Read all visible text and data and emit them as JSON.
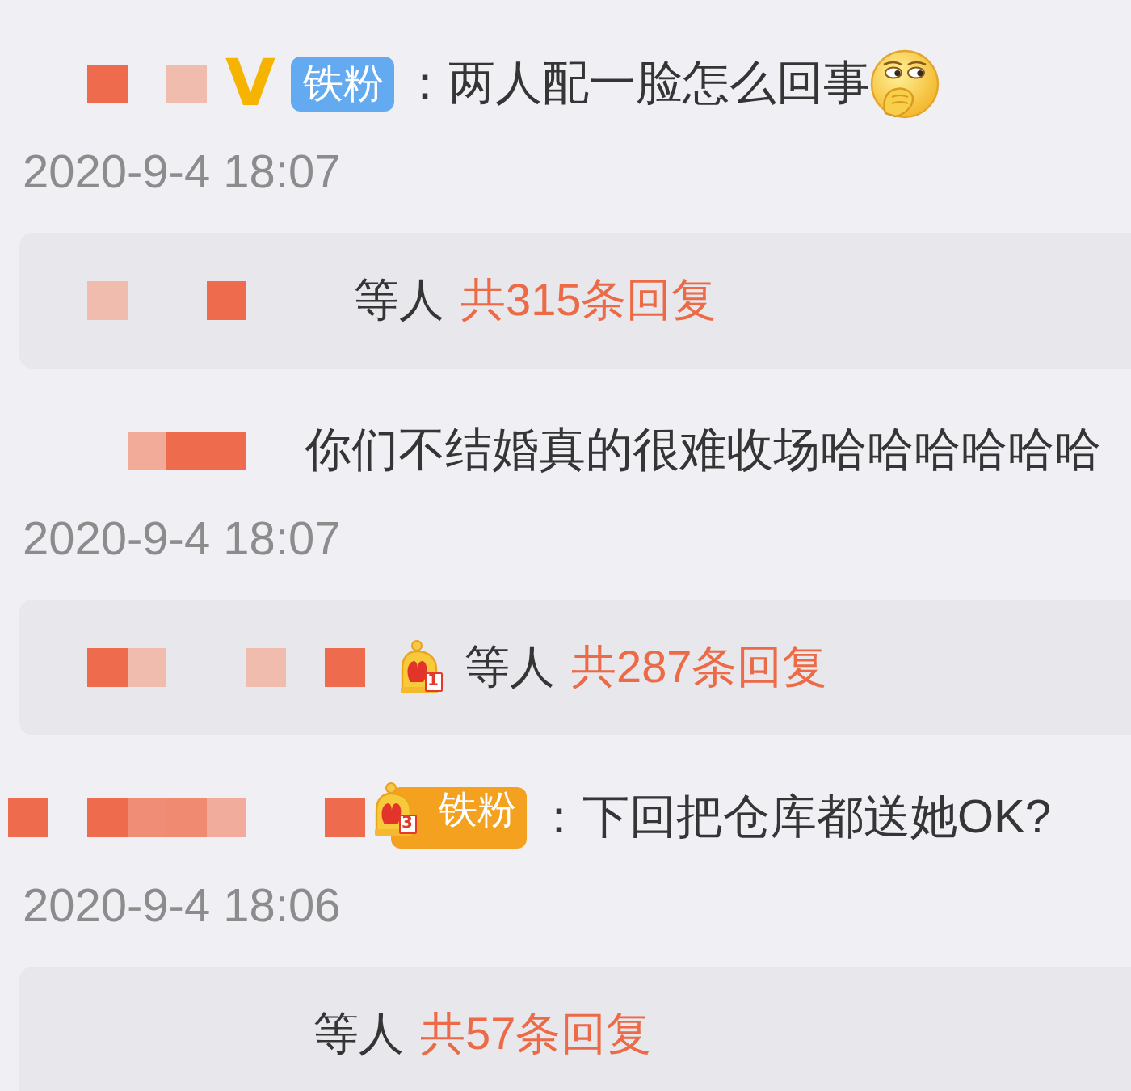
{
  "comments": [
    {
      "name_mosaic": [
        {
          "kind": "blank"
        },
        {
          "kind": "blank"
        },
        {
          "kind": "tile",
          "color": "#ee6c4d"
        },
        {
          "kind": "blank"
        },
        {
          "kind": "tile",
          "color": "#f0bcae"
        }
      ],
      "verified_mark": "V",
      "badge": {
        "kind": "plain",
        "label": "铁粉"
      },
      "text": "：两人配一脸怎么回事",
      "emoji": true,
      "time": "2020-9-4 18:07",
      "replies": {
        "name_mosaic": [
          {
            "kind": "blank"
          },
          {
            "kind": "blank"
          },
          {
            "kind": "tile",
            "color": "#f0bcae"
          },
          {
            "kind": "blank"
          },
          {
            "kind": "blank"
          },
          {
            "kind": "tile",
            "color": "#ee6c4d"
          },
          {
            "kind": "blank"
          },
          {
            "kind": "blank"
          }
        ],
        "label": "等人",
        "count": "共315条回复"
      }
    },
    {
      "name_mosaic": [
        {
          "kind": "blank"
        },
        {
          "kind": "blank"
        },
        {
          "kind": "blank"
        },
        {
          "kind": "tile",
          "color": "#f2ab99"
        },
        {
          "kind": "tile",
          "color": "#ee6c4d"
        },
        {
          "kind": "tile",
          "color": "#ee6c4d"
        },
        {
          "kind": "blank"
        }
      ],
      "text": "你们不结婚真的很难收场哈哈哈哈哈哈",
      "time": "2020-9-4 18:07",
      "replies": {
        "name_mosaic": [
          {
            "kind": "blank"
          },
          {
            "kind": "blank"
          },
          {
            "kind": "tile",
            "color": "#ee6c4d"
          },
          {
            "kind": "tile",
            "color": "#f0bcae"
          },
          {
            "kind": "blank"
          },
          {
            "kind": "blank"
          },
          {
            "kind": "tile",
            "color": "#f0bcae"
          },
          {
            "kind": "blank"
          },
          {
            "kind": "tile",
            "color": "#ee6c4d"
          }
        ],
        "crown_rank": "1",
        "label": "等人",
        "count": "共287条回复"
      }
    },
    {
      "name_mosaic": [
        {
          "kind": "tile",
          "color": "#ee6c4d"
        },
        {
          "kind": "blank"
        },
        {
          "kind": "tile",
          "color": "#ee6c4d"
        },
        {
          "kind": "tile",
          "color": "#f08d76"
        },
        {
          "kind": "tile",
          "color": "#f08a70"
        },
        {
          "kind": "tile",
          "color": "#f2ac9c"
        },
        {
          "kind": "blank"
        },
        {
          "kind": "blank"
        },
        {
          "kind": "tile",
          "color": "#ee6c4d"
        }
      ],
      "badge": {
        "kind": "crown",
        "label": "铁粉",
        "rank": "3"
      },
      "text": "：下回把仓库都送她OK?",
      "time": "2020-9-4 18:06",
      "replies": {
        "label": "等人",
        "count": "共57条回复"
      }
    }
  ]
}
